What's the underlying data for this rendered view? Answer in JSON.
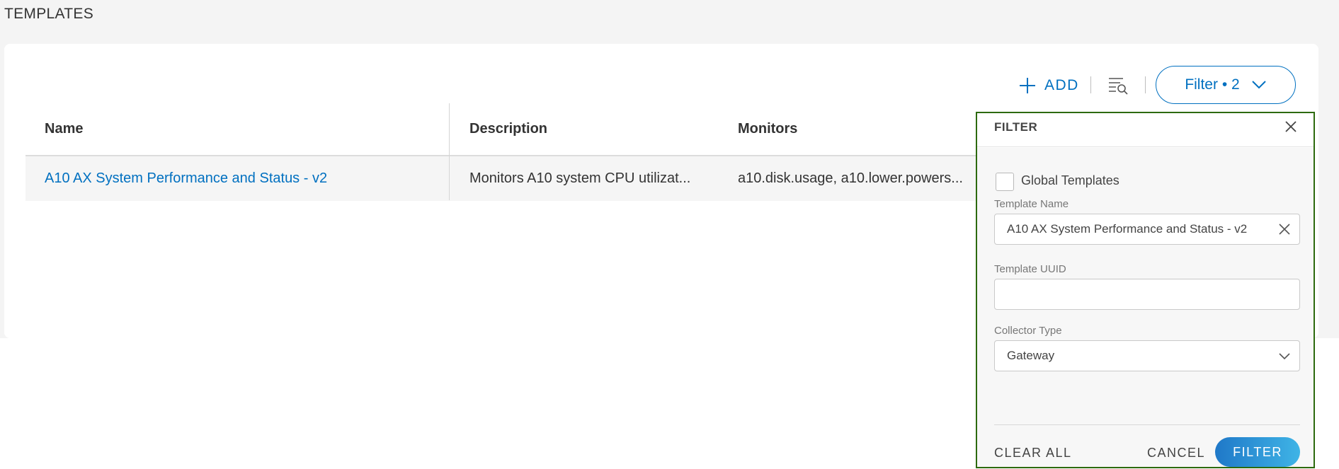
{
  "page": {
    "title": "TEMPLATES"
  },
  "toolbar": {
    "add_label": "ADD",
    "filter_label": "Filter • 2"
  },
  "table": {
    "columns": [
      "Name",
      "Description",
      "Monitors"
    ],
    "rows": [
      {
        "name": "A10 AX System Performance and Status - v2",
        "description": "Monitors A10 system CPU utilizat...",
        "monitors": "a10.disk.usage, a10.lower.powers..."
      }
    ]
  },
  "filter_panel": {
    "title": "FILTER",
    "global_templates_label": "Global Templates",
    "global_templates_checked": false,
    "template_name_label": "Template Name",
    "template_name_value": "A10 AX System Performance and Status - v2",
    "template_uuid_label": "Template UUID",
    "template_uuid_value": "",
    "collector_type_label": "Collector Type",
    "collector_type_value": "Gateway",
    "clear_all_label": "CLEAR ALL",
    "cancel_label": "CANCEL",
    "filter_label": "FILTER"
  },
  "colors": {
    "accent": "#0070c0",
    "panel_border": "#2d6a0e"
  },
  "icons": [
    "plus-icon",
    "search-filter-icon",
    "chevron-down-icon",
    "close-icon",
    "clear-icon"
  ]
}
